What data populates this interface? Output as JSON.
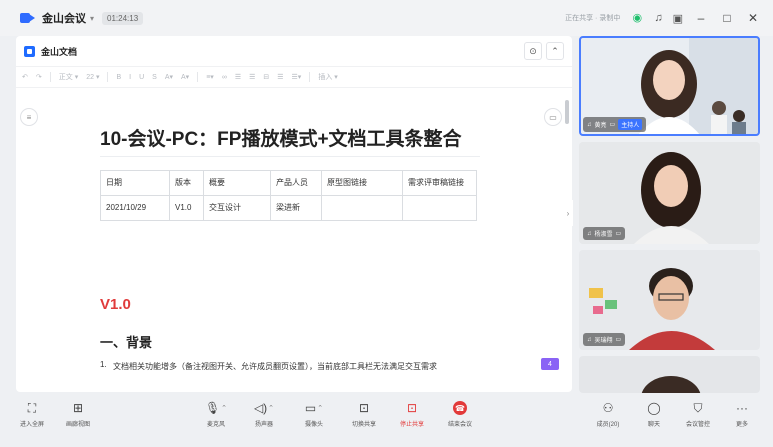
{
  "titlebar": {
    "app_name": "金山会议",
    "timer": "01:24:13",
    "status_text": "正在共享 · 录制中",
    "minimize": "–",
    "maximize": "□",
    "close": "✕"
  },
  "doc": {
    "name": "金山文档",
    "toolbar_items": [
      "↶",
      "↷",
      "正文 ▾",
      "22 ▾",
      "B",
      "I",
      "U",
      "S",
      "A▾",
      "A▾",
      "≡▾",
      "∞",
      "☰",
      "☰",
      "⊟",
      "☰",
      "☰▾",
      "插入 ▾"
    ],
    "title": "10-会议-PC：FP播放模式+文档工具条整合",
    "table": {
      "headers": [
        "日期",
        "版本",
        "概要",
        "产品人员",
        "原型图链接",
        "需求评审稿链接"
      ],
      "rows": [
        [
          "2021/10/29",
          "V1.0",
          "交互设计",
          "梁进新",
          "",
          ""
        ]
      ]
    },
    "h_version": "V1.0",
    "h_section": "一、背景",
    "list_num": "1.",
    "list_text": "文档相关功能增多（备注视图开关、允许成员翻页设置），当前底部工具栏无法满足交互需求",
    "page_badge": "4"
  },
  "participants": [
    {
      "name": "黄亮",
      "host_tag": "主持人"
    },
    {
      "name": "杨淑雪",
      "host_tag": ""
    },
    {
      "name": "吴瑞翔",
      "host_tag": ""
    },
    {
      "name": "",
      "host_tag": ""
    }
  ],
  "bottombar": {
    "fullscreen": "进入全屏",
    "gallery": "画廊视图",
    "mic": "麦克风",
    "speaker": "扬声器",
    "camera": "摄像头",
    "switch_share": "切换共享",
    "stop_share": "停止共享",
    "end_meeting": "结束会议",
    "members": "成员(20)",
    "chat": "聊天",
    "security": "会议管控",
    "more": "更多"
  },
  "colors": {
    "accent": "#3b74ff",
    "danger": "#e23a3a",
    "badge": "#8a63f5"
  }
}
